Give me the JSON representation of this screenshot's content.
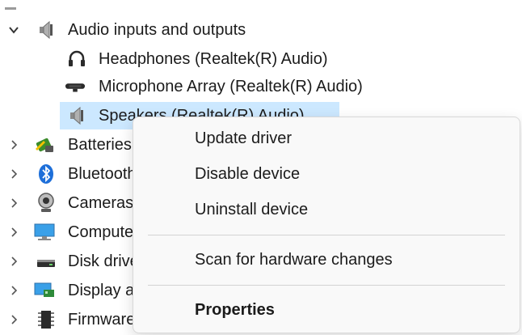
{
  "tree": {
    "category": {
      "label": "Audio inputs and outputs",
      "icon": "speaker-icon",
      "expanded": true
    },
    "children": [
      {
        "label": "Headphones (Realtek(R) Audio)",
        "icon": "headphones-icon"
      },
      {
        "label": "Microphone Array (Realtek(R) Audio)",
        "icon": "microphone-icon"
      },
      {
        "label": "Speakers (Realtek(R) Audio)",
        "icon": "speaker-icon",
        "selected": true
      }
    ],
    "collapsed": [
      {
        "label": "Batteries",
        "icon": "battery-icon"
      },
      {
        "label": "Bluetooth",
        "icon": "bluetooth-icon"
      },
      {
        "label": "Cameras",
        "icon": "camera-icon"
      },
      {
        "label": "Computer",
        "icon": "computer-icon"
      },
      {
        "label": "Disk drives",
        "icon": "disk-drive-icon"
      },
      {
        "label": "Display adapters",
        "icon": "display-adapter-icon"
      },
      {
        "label": "Firmware",
        "icon": "firmware-icon"
      }
    ]
  },
  "context_menu": {
    "items": [
      {
        "label": "Update driver"
      },
      {
        "label": "Disable device"
      },
      {
        "label": "Uninstall device"
      },
      {
        "label": "Scan for hardware changes"
      },
      {
        "label": "Properties",
        "bold": true
      }
    ]
  },
  "colors": {
    "selection": "#cce8ff",
    "menu_bg": "#f9f9f9",
    "text": "#1b1b1b",
    "bluetooth": "#1e6fd9"
  }
}
